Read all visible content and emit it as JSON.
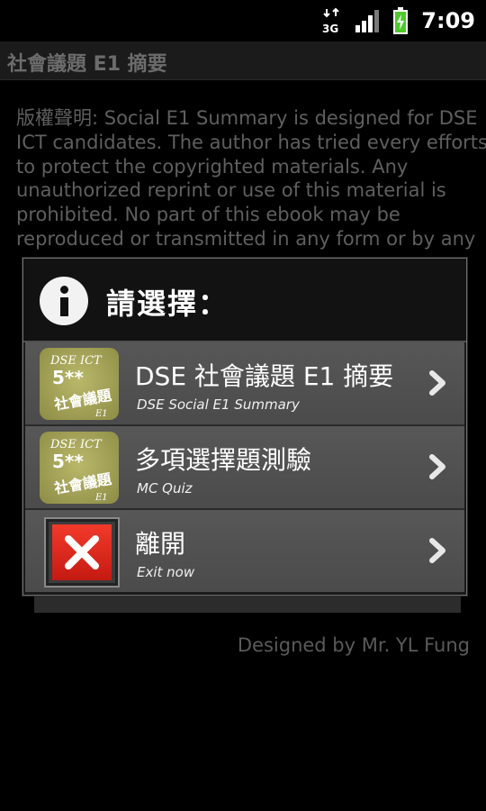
{
  "status_bar": {
    "network": "3G",
    "time": "7:09",
    "icons": [
      "network-3g-icon",
      "signal-strength-icon",
      "battery-charging-icon"
    ]
  },
  "app_title": "社會議題 E1 摘要",
  "background": {
    "lines": [
      "版權聲明: Social E1 Summary is designed for DSE",
      "ICT candidates. The author has tried every efforts",
      "to protect the copyrighted materials. Any",
      "unauthorized reprint or use of this material is",
      "prohibited.  No part of this ebook may be",
      "reproduced or transmitted in any form or by any"
    ],
    "footer": "Designed by Mr. YL Fung"
  },
  "dialog": {
    "title": "請選擇：",
    "icon": "info-icon",
    "items": [
      {
        "label": "DSE 社會議題 E1 摘要",
        "sublabel": "DSE Social E1 Summary",
        "icon": "dse-ict-app-icon"
      },
      {
        "label": "多項選擇題測驗",
        "sublabel": "MC Quiz",
        "icon": "dse-ict-app-icon"
      },
      {
        "label": "離開",
        "sublabel": "Exit now",
        "icon": "exit-x-icon"
      }
    ],
    "app_icon_text": {
      "top": "DSE  ICT",
      "mid": "5**",
      "main": "社會議題",
      "corner": "E1"
    }
  },
  "colors": {
    "dialog_bg": "#1a1a1a",
    "item_bg": "#515151",
    "exit_red": "#e02b1f",
    "icon_gold": "#a9a85a"
  }
}
